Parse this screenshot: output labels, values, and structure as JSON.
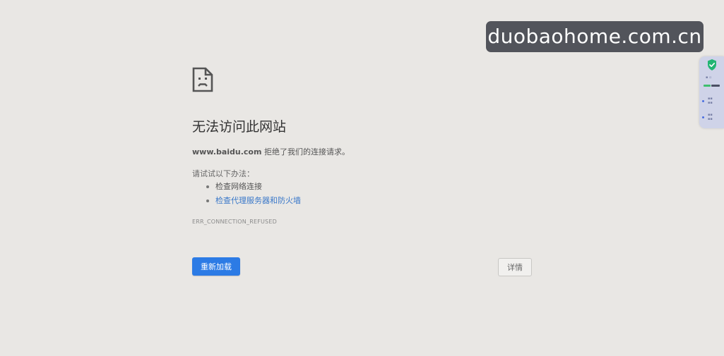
{
  "watermark": {
    "text": "duobaohome.com.cn"
  },
  "error_page": {
    "icon": "sad-page-icon",
    "title": "无法访问此网站",
    "host": "www.baidu.com",
    "description_suffix": " 拒绝了我们的连接请求。",
    "try_label": "请试试以下办法：",
    "suggestions": [
      {
        "label": "检查网络连接",
        "is_link": false
      },
      {
        "label": "检查代理服务器和防火墙",
        "is_link": true
      }
    ],
    "error_code": "ERR_CONNECTION_REFUSED",
    "reload_label": "重新加载",
    "details_label": "详情"
  },
  "side_widget": {
    "icon": "shield-check-icon",
    "shield_color": "#22b573",
    "background_color": "#cfd3e8"
  },
  "colors": {
    "page_background": "#e9e7e4",
    "primary_button": "#2c7be5",
    "link": "#3a78c9"
  }
}
